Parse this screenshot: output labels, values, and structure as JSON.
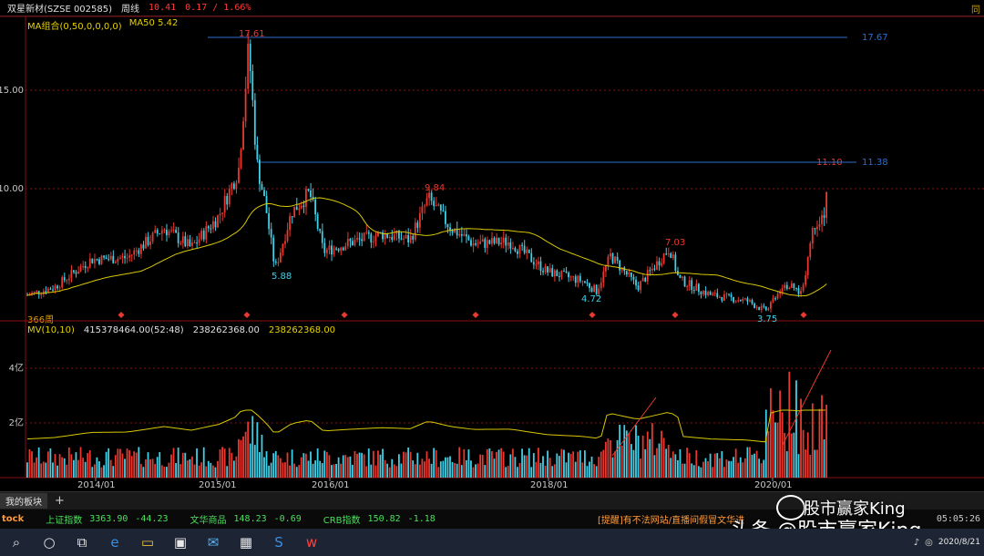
{
  "header": {
    "title": "双星新材(SZSE 002585)",
    "period": "周线",
    "price": "10.41",
    "change": "0.17 / 1.66%",
    "right_marker": "同"
  },
  "price_legend": {
    "ma_group": "MA组合(0,50,0,0,0,0)",
    "ma50": "MA50 5.42"
  },
  "period_count": "366周",
  "volume_legend": {
    "name": "MV(10,10)",
    "v1": "415378464.00(52:48)",
    "v2": "238262368.00",
    "v3": "238262368.00"
  },
  "price_axis_labels": [
    "15.00",
    "10.00"
  ],
  "volume_axis_labels": [
    "4亿",
    "2亿"
  ],
  "x_axis_labels": [
    "2014/01",
    "2015/01",
    "2016/01",
    "2018/01",
    "2020/01"
  ],
  "annotations": {
    "high_label": "17.61",
    "resist_label": "17.67",
    "mid_label": "11.10",
    "mid_right_label": "11.38",
    "p984": "9.84",
    "p703": "7.03",
    "p588": "5.88",
    "p472": "4.72",
    "p375": "3.75"
  },
  "tabs": {
    "active": "我的板块",
    "add": "+"
  },
  "ticker": {
    "brand": "tock",
    "items": [
      {
        "name": "上证指数",
        "value": "3363.90",
        "change": "-44.23"
      },
      {
        "name": "文华商品",
        "value": "148.23",
        "change": "-0.69"
      },
      {
        "name": "CRB指数",
        "value": "150.82",
        "change": "-1.18"
      }
    ],
    "alert": "[提醒]有不法网站/直播间假冒文华进",
    "clock": "05:05:26"
  },
  "watermark": {
    "top": "股市赢家King",
    "bottom": "头条 @股市赢家King"
  },
  "taskbar": {
    "time": "",
    "date": "2020/8/21"
  },
  "colors": {
    "up": "#e8382f",
    "down": "#3fd0e8",
    "ma": "#d8c800",
    "grid_red": "#8a1010",
    "line_blue": "#2b6ecf"
  },
  "chart_data": [
    {
      "type": "candlestick",
      "title": "双星新材(SZSE 002585) 周线",
      "ylabel": "",
      "y_ticks": [
        10.0,
        15.0
      ],
      "x_ticks": [
        "2014/01",
        "2015/01",
        "2016/01",
        "2018/01",
        "2020/01"
      ],
      "series": [
        {
          "name": "MA50",
          "latest": 5.42
        }
      ],
      "marked_points": [
        {
          "label": "17.61",
          "value": 17.61,
          "date": "2015/06"
        },
        {
          "label": "5.88",
          "value": 5.88,
          "date": "2015/09"
        },
        {
          "label": "9.84",
          "value": 9.84,
          "date": "2017/03"
        },
        {
          "label": "4.72",
          "value": 4.72,
          "date": "2018/10"
        },
        {
          "label": "7.03",
          "value": 7.03,
          "date": "2019/04"
        },
        {
          "label": "3.75",
          "value": 3.75,
          "date": "2020/02"
        },
        {
          "label": "11.10",
          "value": 11.1,
          "date": "2020/08"
        }
      ],
      "horizontal_lines": [
        17.67,
        11.38
      ]
    },
    {
      "type": "bar",
      "title": "MV(10,10)",
      "y_ticks": [
        "2亿",
        "4亿"
      ],
      "latest_volume": 415378464.0
    }
  ]
}
